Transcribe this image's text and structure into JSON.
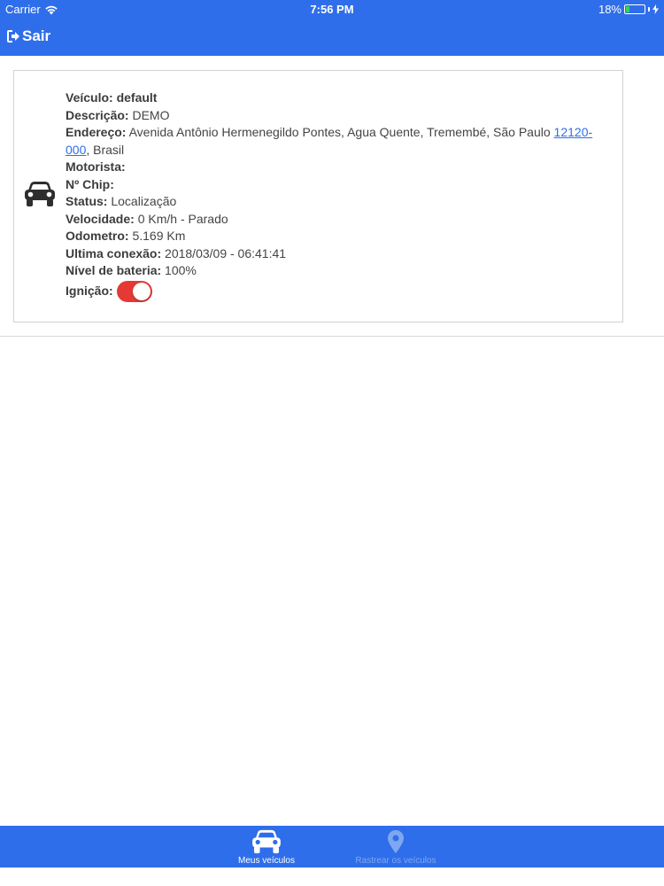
{
  "status_bar": {
    "carrier": "Carrier",
    "time": "7:56 PM",
    "battery_percent": "18%",
    "battery_level": 0.18,
    "battery_color": "#37d64b"
  },
  "header": {
    "logout_label": "Sair",
    "background_color": "#2f6eea"
  },
  "vehicle": {
    "veiculo_label": "Veículo:",
    "veiculo_value": "default",
    "descricao_label": "Descrição:",
    "descricao_value": "DEMO",
    "endereco_label": "Endereço:",
    "endereco_value": "Avenida Antônio Hermenegildo Pontes, Agua Quente, Tremembé, São Paulo",
    "endereco_cep": "12120-000",
    "endereco_country": ", Brasil",
    "motorista_label": "Motorista:",
    "motorista_value": "",
    "chip_label": "Nº Chip:",
    "chip_value": "",
    "status_label": "Status:",
    "status_value": "Localização",
    "velocidade_label": "Velocidade:",
    "velocidade_value": "0 Km/h - Parado",
    "odometro_label": "Odometro:",
    "odometro_value": "5.169 Km",
    "ultima_conexao_label": "Ultima conexão:",
    "ultima_conexao_value": "2018/03/09 - 06:41:41",
    "bateria_label": "Nível de bateria:",
    "bateria_value": "100%",
    "ignicao_label": "Ignição:",
    "ignicao_on": true,
    "toggle_color": "#e53935",
    "link_color": "#2f6eea",
    "icon": "car-icon"
  },
  "tabbar": {
    "tabs": [
      {
        "label": "Meus veículos",
        "icon": "car-icon",
        "active": true
      },
      {
        "label": "Rastrear os veículos",
        "icon": "map-pin-icon",
        "active": false
      }
    ]
  }
}
